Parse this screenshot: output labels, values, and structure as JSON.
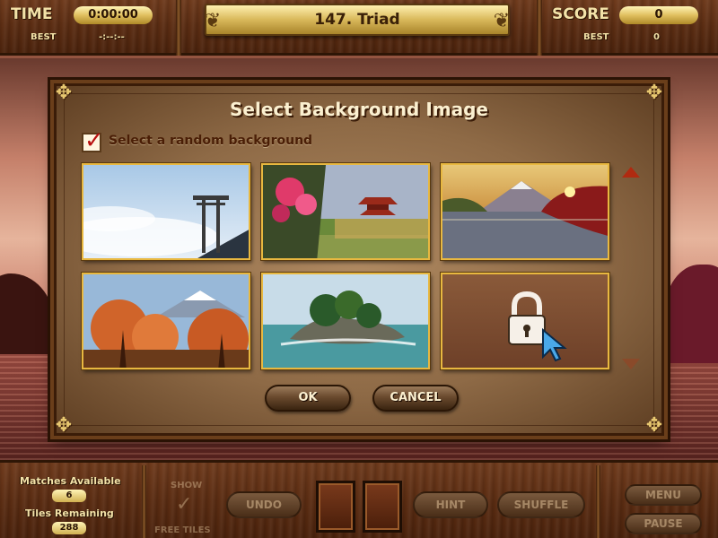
{
  "hud": {
    "time_label": "TIME",
    "time_value": "0:00:00",
    "time_best_label": "BEST",
    "time_best_value": "-:--:--",
    "level_title": "147. Triad",
    "score_label": "SCORE",
    "score_value": "0",
    "score_best_label": "BEST",
    "score_best_value": "0"
  },
  "dialog": {
    "title": "Select Background Image",
    "random_label": "Select a random background",
    "random_checked": true,
    "thumbnails": [
      {
        "name": "torii-gate-clouds",
        "locked": false
      },
      {
        "name": "pagoda-cherry-blossom",
        "locked": false
      },
      {
        "name": "mountain-lake-sunset",
        "locked": false
      },
      {
        "name": "fuji-autumn-trees",
        "locked": false
      },
      {
        "name": "island-pine-sea",
        "locked": false
      },
      {
        "name": "locked-slot",
        "locked": true
      }
    ],
    "ok_label": "OK",
    "cancel_label": "CANCEL"
  },
  "bottom": {
    "matches_label": "Matches Available",
    "matches_value": "6",
    "tiles_label": "Tiles Remaining",
    "tiles_value": "288",
    "show_label": "SHOW",
    "free_tiles_label": "FREE TILES",
    "undo_label": "UNDO",
    "hint_label": "HINT",
    "shuffle_label": "SHUFFLE",
    "menu_label": "MENU",
    "pause_label": "PAUSE"
  },
  "icons": {
    "lock": "lock-icon",
    "cursor": "cursor-arrow-icon",
    "arrow_up": "scroll-up-icon",
    "arrow_down": "scroll-down-icon"
  }
}
